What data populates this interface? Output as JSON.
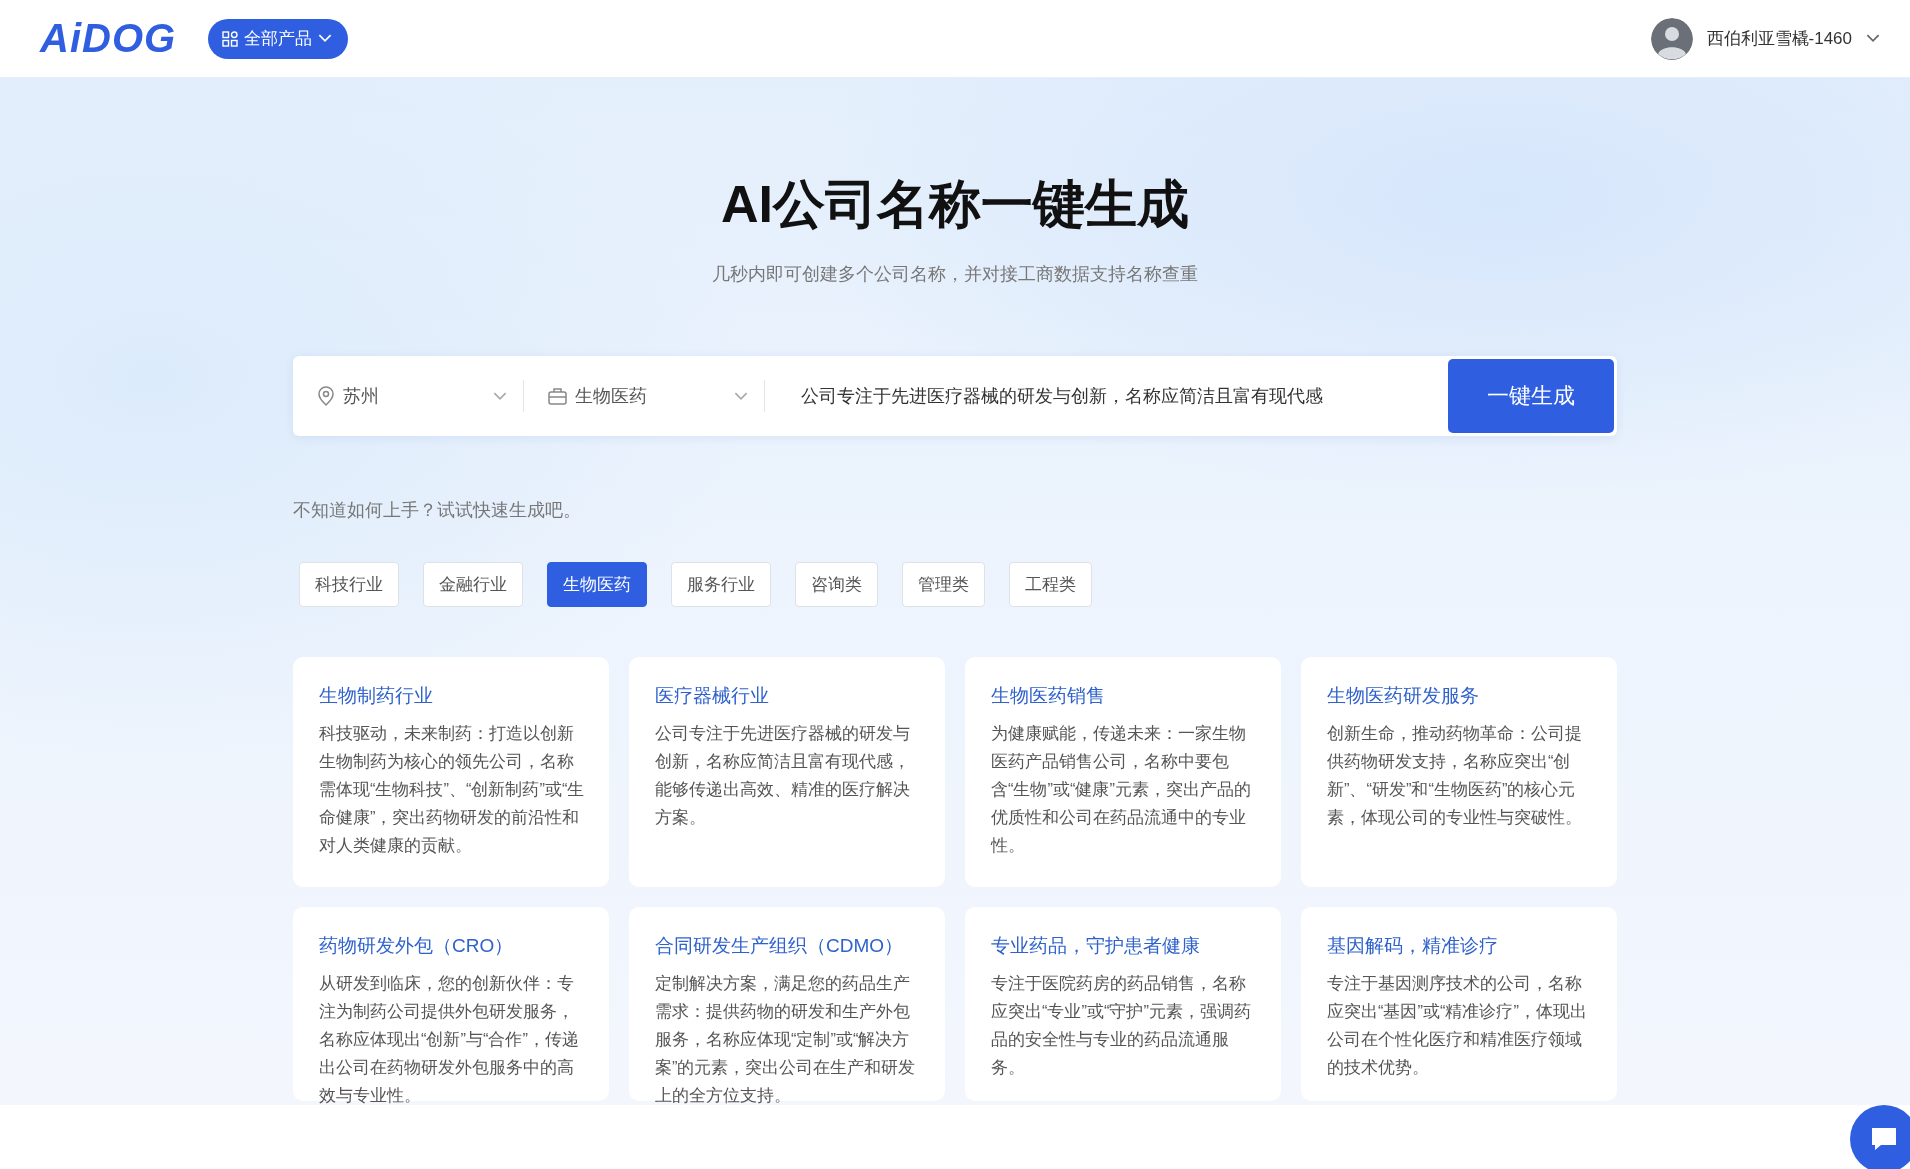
{
  "header": {
    "logo": "AiDOG",
    "products_button": "全部产品",
    "user": {
      "name": "西伯利亚雪橇-1460"
    }
  },
  "hero": {
    "title": "AI公司名称一键生成",
    "subtitle": "几秒内即可创建多个公司名称，并对接工商数据支持名称查重"
  },
  "search": {
    "city": "苏州",
    "industry": "生物医药",
    "description": "公司专注于先进医疗器械的研发与创新，名称应简洁且富有现代感",
    "submit": "一键生成"
  },
  "hint": "不知道如何上手？试试快速生成吧。",
  "tags": [
    {
      "label": "科技行业",
      "selected": false
    },
    {
      "label": "金融行业",
      "selected": false
    },
    {
      "label": "生物医药",
      "selected": true
    },
    {
      "label": "服务行业",
      "selected": false
    },
    {
      "label": "咨询类",
      "selected": false
    },
    {
      "label": "管理类",
      "selected": false
    },
    {
      "label": "工程类",
      "selected": false
    }
  ],
  "cards": [
    {
      "title": "生物制药行业",
      "text": "科技驱动，未来制药：打造以创新生物制药为核心的领先公司，名称需体现“生物科技”、“创新制药”或“生命健康”，突出药物研发的前沿性和对人类健康的贡献。"
    },
    {
      "title": "医疗器械行业",
      "text": "公司专注于先进医疗器械的研发与创新，名称应简洁且富有现代感，能够传递出高效、精准的医疗解决方案。"
    },
    {
      "title": "生物医药销售",
      "text": "为健康赋能，传递未来：一家生物医药产品销售公司，名称中要包含“生物”或“健康”元素，突出产品的优质性和公司在药品流通中的专业性。"
    },
    {
      "title": "生物医药研发服务",
      "text": "创新生命，推动药物革命：公司提供药物研发支持，名称应突出“创新”、“研发”和“生物医药”的核心元素，体现公司的专业性与突破性。"
    },
    {
      "title": "药物研发外包（CRO）",
      "text": "从研发到临床，您的创新伙伴：专注为制药公司提供外包研发服务，名称应体现出“创新”与“合作”，传递出公司在药物研发外包服务中的高效与专业性。"
    },
    {
      "title": "合同研发生产组织（CDMO）",
      "text": "定制解决方案，满足您的药品生产需求：提供药物的研发和生产外包服务，名称应体现“定制”或“解决方案”的元素，突出公司在生产和研发上的全方位支持。"
    },
    {
      "title": "专业药品，守护患者健康",
      "text": "专注于医院药房的药品销售，名称应突出“专业”或“守护”元素，强调药品的安全性与专业的药品流通服务。"
    },
    {
      "title": "基因解码，精准诊疗",
      "text": "专注于基因测序技术的公司，名称应突出“基因”或“精准诊疗”，体现出公司在个性化医疗和精准医疗领域的技术优势。"
    }
  ]
}
